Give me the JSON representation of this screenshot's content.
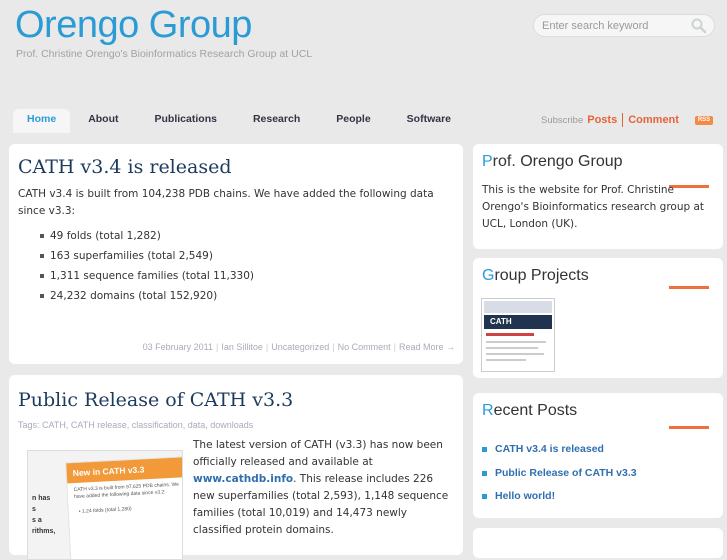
{
  "header": {
    "title": "Orengo Group",
    "description": "Prof. Christine Orengo's Bioinformatics Research Group at UCL"
  },
  "search": {
    "placeholder": "Enter search keyword",
    "icon": "magnifier-icon"
  },
  "nav": {
    "items": [
      "Home",
      "About",
      "Publications",
      "Research",
      "People",
      "Software"
    ],
    "active": "Home"
  },
  "feeds": {
    "subscribe": "Subscribe",
    "posts": "Posts",
    "comment": "Comment",
    "rss": "RSS"
  },
  "posts": [
    {
      "title": "CATH v3.4 is released",
      "intro": "CATH v3.4 is built from 104,238 PDB chains. We have added the following data since v3.3:",
      "bullets": [
        "49 folds (total 1,282)",
        "163 superfamilies (total 2,549)",
        "1,311 sequence families (total 11,330)",
        "24,232 domains (total 152,920)"
      ],
      "date": "03 February 2011",
      "author": "Ian Sillitoe",
      "category": "Uncategorized",
      "comments": "No Comment",
      "read_more": "Read More →"
    },
    {
      "title": "Public Release of CATH v3.3",
      "tags_label": "Tags:",
      "tags": "CATH, CATH release, classification, data, downloads",
      "body_before": "The latest version of CATH (v3.3) has now been officially released and available at ",
      "link": "www.cathdb.info",
      "body_after": ". This release includes 226 new superfamilies (total 2,593), 1,148 sequence families (total 10,019) and 14,473 newly classified protein domains.",
      "thumb_banner": "New in CATH v3.3",
      "thumb_text": "CATH v3.3 is built from 97,625 PDB chains. We have added the following data since v3.2:",
      "thumb_bullet": "• 1.24 folds (total 1,280)",
      "thumb_left": "n has\ns\ns a\nrithms,"
    }
  ],
  "sidebar": {
    "about": {
      "title_first": "P",
      "title_rest": "rof. Orengo Group",
      "text": "This is the website for Prof. Christine Orengo's Bioinformatics research group at UCL, London (UK)."
    },
    "projects": {
      "title_first": "G",
      "title_rest": "roup Projects",
      "thumb_label": "CATH"
    },
    "recent": {
      "title_first": "R",
      "title_rest": "ecent Posts",
      "items": [
        "CATH v3.4 is released",
        "Public Release of CATH v3.3",
        "Hello world!"
      ]
    }
  },
  "colors": {
    "brand_blue": "#2b9bd6",
    "accent_orange": "#e8633a",
    "link_blue": "#2f6fb0"
  }
}
